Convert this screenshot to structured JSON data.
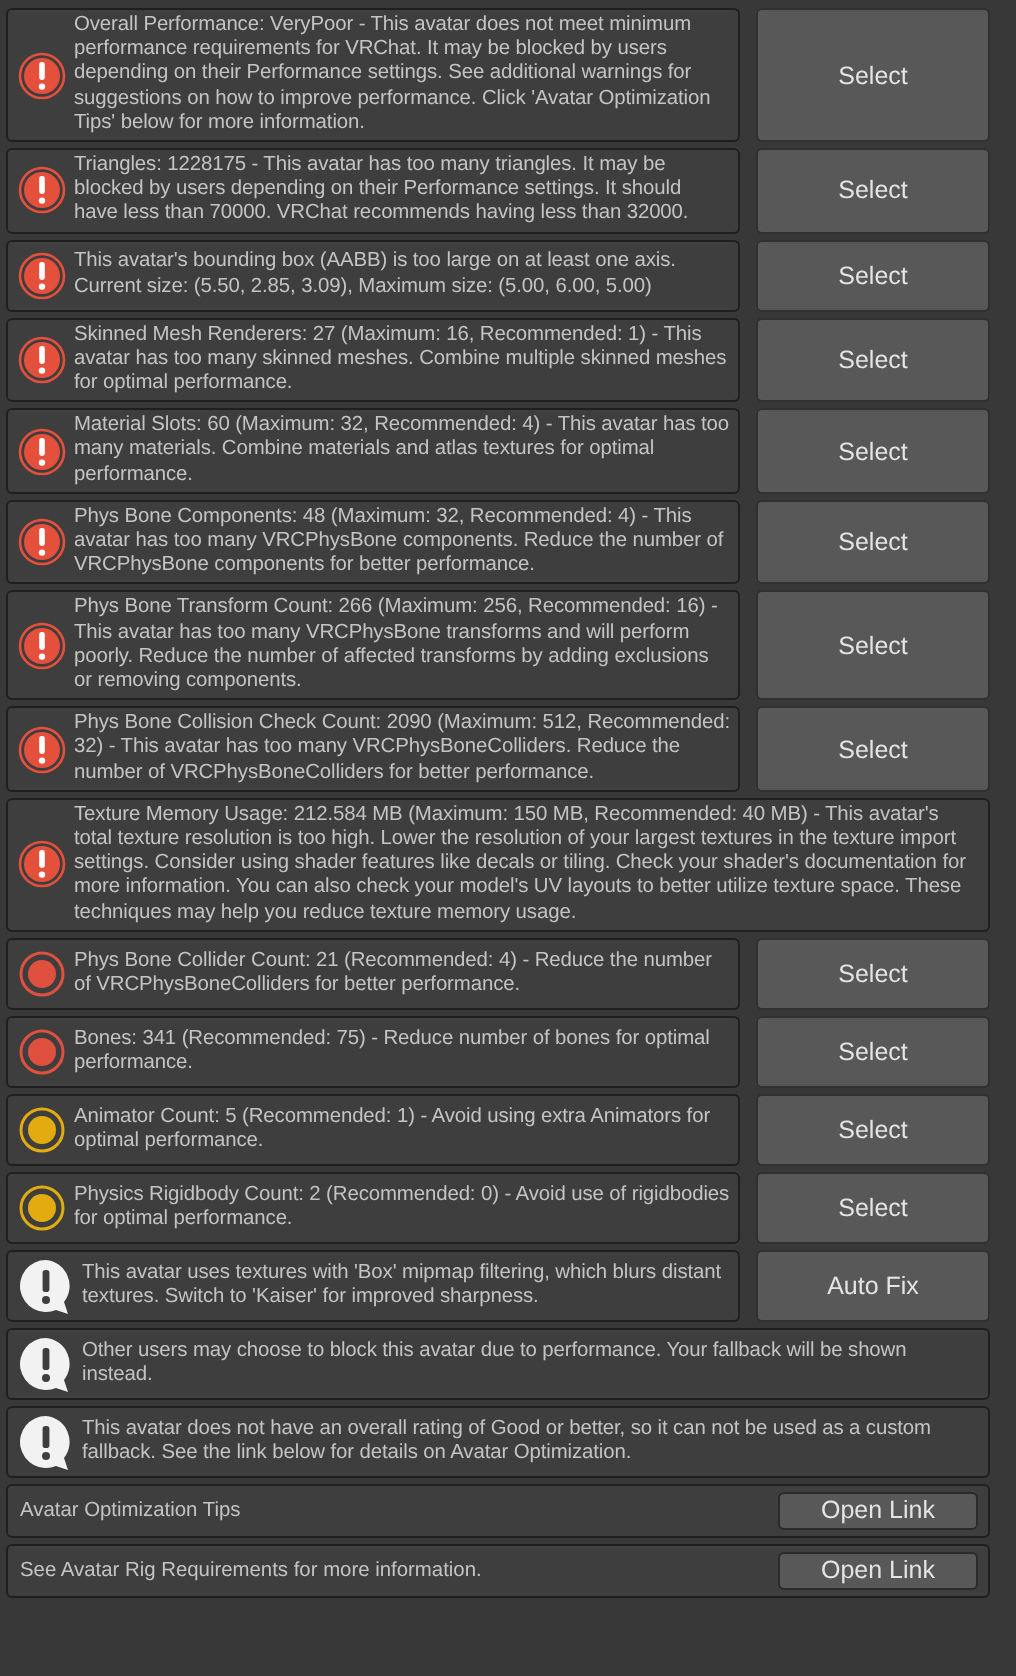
{
  "messages": [
    {
      "kind": "error",
      "text": "Overall Performance: VeryPoor - This avatar does not meet minimum performance requirements for VRChat. It may be blocked by users depending on their Performance settings. See additional warnings for suggestions on how to improve performance. Click 'Avatar Optimization Tips' below for more information.",
      "action": "Select"
    },
    {
      "kind": "error",
      "text": "Triangles: 1228175 - This avatar has too many triangles. It may be blocked by users depending on their Performance settings. It should have less than 70000. VRChat recommends having less than 32000.",
      "action": "Select"
    },
    {
      "kind": "error",
      "text": "This avatar's bounding box (AABB) is too large on at least one axis. Current size: (5.50, 2.85, 3.09), Maximum size: (5.00, 6.00, 5.00)",
      "action": "Select"
    },
    {
      "kind": "error",
      "text": "Skinned Mesh Renderers: 27 (Maximum: 16, Recommended: 1) - This avatar has too many skinned meshes. Combine multiple skinned meshes for optimal performance.",
      "action": "Select"
    },
    {
      "kind": "error",
      "text": "Material Slots: 60 (Maximum: 32, Recommended: 4) - This avatar has too many materials. Combine materials and atlas textures for optimal performance.",
      "action": "Select"
    },
    {
      "kind": "error",
      "text": "Phys Bone Components: 48 (Maximum: 32, Recommended: 4) - This avatar has too many VRCPhysBone components. Reduce the number of VRCPhysBone components for better performance.",
      "action": "Select"
    },
    {
      "kind": "error",
      "text": "Phys Bone Transform Count: 266 (Maximum: 256, Recommended: 16) - This avatar has too many VRCPhysBone transforms and will perform poorly. Reduce the number of affected transforms by adding exclusions or removing components.",
      "action": "Select"
    },
    {
      "kind": "error",
      "text": "Phys Bone Collision Check Count: 2090 (Maximum: 512, Recommended: 32) - This avatar has too many VRCPhysBoneColliders. Reduce the number of VRCPhysBoneColliders for better performance.",
      "action": "Select"
    },
    {
      "kind": "error",
      "text": "Texture Memory Usage: 212.584 MB (Maximum: 150 MB, Recommended: 40 MB) - This avatar's total texture resolution is too high. Lower the resolution of your largest textures in the texture import settings. Consider using shader features like decals or tiling. Check your shader's documentation for more information. You can also check your model's UV layouts to better utilize texture space. These techniques may help you reduce texture memory usage."
    },
    {
      "kind": "dot",
      "color": "#e0503f",
      "text": "Phys Bone Collider Count: 21 (Recommended: 4) - Reduce the number of VRCPhysBoneColliders for better performance.",
      "action": "Select"
    },
    {
      "kind": "dot",
      "color": "#e0503f",
      "text": "Bones: 341 (Recommended: 75) - Reduce number of bones for optimal performance.",
      "action": "Select"
    },
    {
      "kind": "dot",
      "color": "#e2ac10",
      "text": "Animator Count: 5 (Recommended: 1) - Avoid using extra Animators for optimal performance.",
      "action": "Select"
    },
    {
      "kind": "dot",
      "color": "#e2ac10",
      "text": "Physics Rigidbody Count: 2 (Recommended: 0) - Avoid use of rigidbodies for optimal performance.",
      "action": "Select"
    },
    {
      "kind": "info",
      "text": "This avatar uses textures with 'Box' mipmap filtering, which blurs distant textures. Switch to 'Kaiser' for improved sharpness.",
      "action": "Auto Fix"
    },
    {
      "kind": "info",
      "text": "Other users may choose to block this avatar due to performance. Your fallback will be shown instead."
    },
    {
      "kind": "info",
      "text": "This avatar does not have an overall rating of Good or better, so it can not be used as a custom fallback. See the link below for details on Avatar Optimization."
    }
  ],
  "links": [
    {
      "label": "Avatar Optimization Tips",
      "button": "Open Link"
    },
    {
      "label": "See Avatar Rig Requirements for more information.",
      "button": "Open Link"
    }
  ]
}
